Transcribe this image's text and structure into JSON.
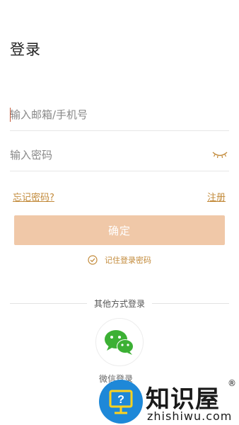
{
  "header": {
    "title": "登录"
  },
  "form": {
    "email_placeholder": "输入邮箱/手机号",
    "password_placeholder": "输入密码",
    "forgot_label": "忘记密码?",
    "register_label": "注册",
    "confirm_label": "确定",
    "remember_label": "记住登录密码",
    "remember_checked": true
  },
  "social": {
    "divider_label": "其他方式登录",
    "wechat_label": "微信登录"
  },
  "watermark": {
    "brand": "知识屋",
    "domain": "zhishiwu.com",
    "registered": "®"
  },
  "colors": {
    "accent": "#c28a3a",
    "button_bg": "#f0c8a8",
    "wechat_green": "#3cb034",
    "watermark_blue": "#1e88d8"
  },
  "icons": {
    "password_toggle": "eye-closed-icon",
    "remember": "check-circle-icon",
    "social": "wechat-icon",
    "watermark": "help-monitor-icon"
  }
}
